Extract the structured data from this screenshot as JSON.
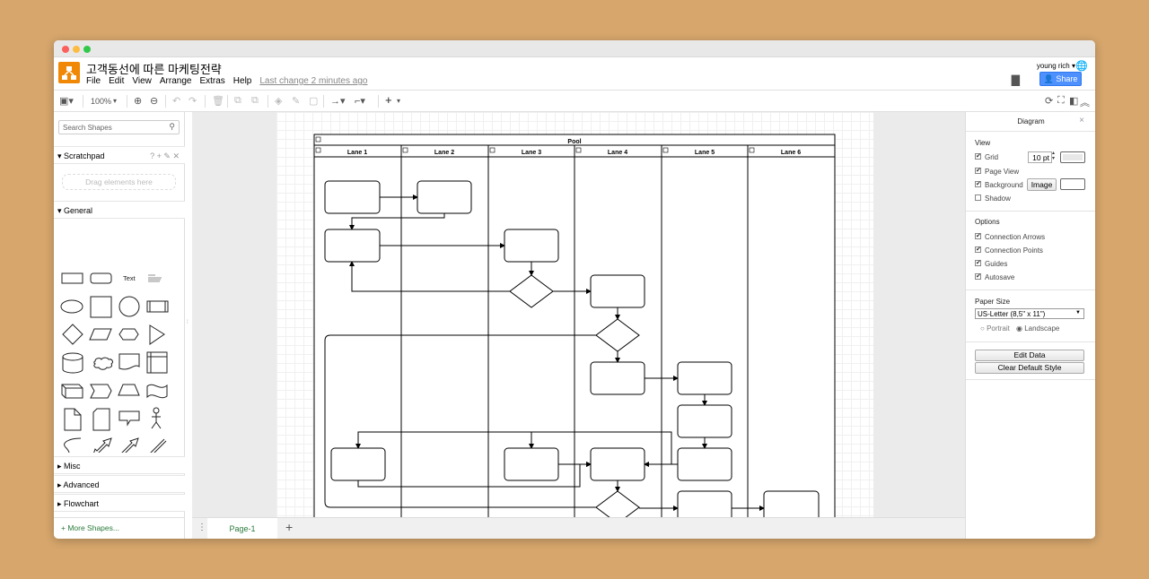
{
  "window": {
    "controls": [
      "close",
      "minimize",
      "maximize"
    ],
    "control_colors": [
      "#fc605c",
      "#fdbc40",
      "#34c84a"
    ]
  },
  "header": {
    "title": "고객동선에 따른 마케팅전략",
    "menu": [
      "File",
      "Edit",
      "View",
      "Arrange",
      "Extras",
      "Help"
    ],
    "last_change": "Last change 2 minutes ago",
    "user": "young rich ▾",
    "share_label": "Share",
    "brand_color": "#f08705",
    "share_color": "#4d90fe"
  },
  "toolbar": {
    "zoom": "100%"
  },
  "sidebar": {
    "search_placeholder": "Search Shapes",
    "scratchpad": "Scratchpad",
    "scratchpad_tools": "? + ✎ ✕",
    "drop_hint": "Drag elements here",
    "general": "General",
    "text_shape": "Text",
    "sections": [
      "Misc",
      "Advanced",
      "Flowchart"
    ],
    "more_shapes": "+ More Shapes..."
  },
  "diagram": {
    "pool": "Pool",
    "lanes": [
      "Lane 1",
      "Lane 2",
      "Lane 3",
      "Lane 4",
      "Lane 5",
      "Lane 6"
    ]
  },
  "pages": {
    "current": "Page-1",
    "add": "+"
  },
  "panel": {
    "title": "Diagram",
    "close": "×",
    "view_heading": "View",
    "grid": "Grid",
    "grid_size": "10 pt",
    "page_view": "Page View",
    "background": "Background",
    "image_button": "Image",
    "shadow": "Shadow",
    "options_heading": "Options",
    "options": [
      "Connection Arrows",
      "Connection Points",
      "Guides",
      "Autosave"
    ],
    "paper_heading": "Paper Size",
    "paper": "US-Letter (8,5\" x 11\")",
    "portrait": "Portrait",
    "landscape": "Landscape",
    "orientation": "Landscape",
    "edit_data": "Edit Data",
    "clear_style": "Clear Default Style",
    "checks": {
      "grid": true,
      "page_view": true,
      "background": true,
      "shadow": false,
      "connection_arrows": true,
      "connection_points": true,
      "guides": true,
      "autosave": true
    }
  }
}
